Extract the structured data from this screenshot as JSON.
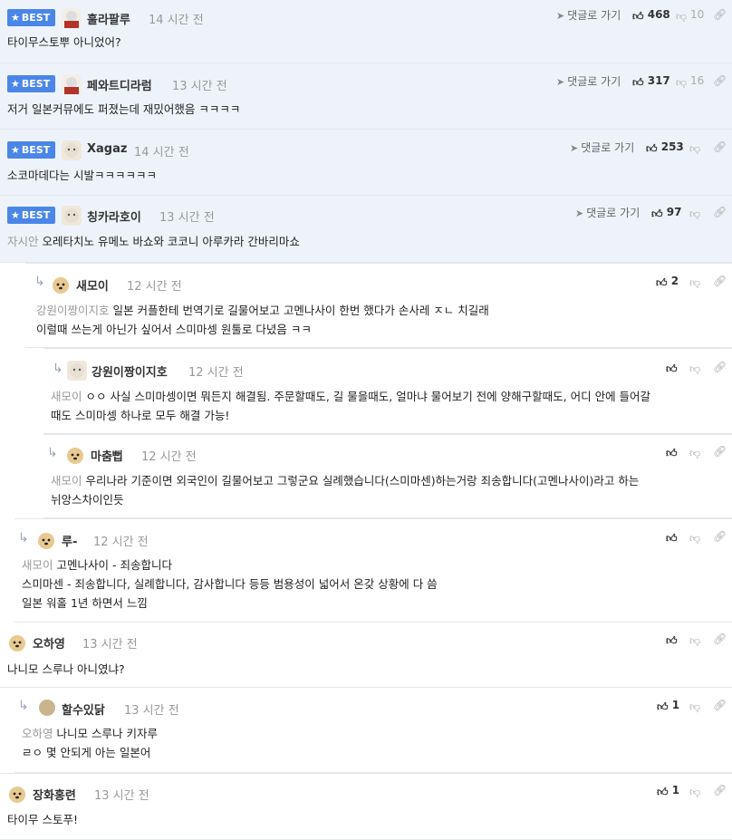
{
  "labels": {
    "best": "BEST",
    "goto": "댓글로 가기",
    "ago": "시간 전"
  },
  "comments": [
    {
      "nick": "훌라팔루",
      "time": "14 시간 전",
      "up": "468",
      "down": "10",
      "text": "타이무스토뿌 아니었어?",
      "mention": ""
    },
    {
      "nick": "페와트디라럼",
      "time": "13 시간 전",
      "up": "317",
      "down": "16",
      "text": "저거 일본커뮤에도 퍼졌는데 재밌어했음 ㅋㅋㅋㅋ",
      "mention": ""
    },
    {
      "nick": "Xagaz",
      "time": "14 시간 전",
      "up": "253",
      "down": "",
      "text": "소코마데다는 시발ㅋㅋㅋㅋㅋㅋ",
      "mention": ""
    },
    {
      "nick": "칭카라호이",
      "time": "13 시간 전",
      "up": "97",
      "down": "",
      "text": "오레타치노 유메노 바쇼와 코코니 아루카라 간바리마쇼",
      "mention": "자시안"
    },
    {
      "nick": "새모이",
      "time": "12 시간 전",
      "up": "2",
      "down": "",
      "text": "일본 커플한테 번역기로 길물어보고 고멘나사이 한번 했다가 손사레 ㅈㄴ 치길래",
      "text2": "이럴때 쓰는게 아닌가 싶어서 스미마셍 원툴로 다녔음 ㅋㅋ",
      "mention": "강원이짱이지호"
    },
    {
      "nick": "강원이짱이지호",
      "time": "12 시간 전",
      "up": "",
      "down": "",
      "text": "ㅇㅇ 사실 스미마셍이면 뭐든지 해결됨. 주문할때도, 길 물을때도, 얼마냐 물어보기 전에 양해구할때도, 어디 안에 들어갈",
      "text2": "때도 스미마셍 하나로 모두 해결 가능!",
      "mention": "새모이"
    },
    {
      "nick": "마춤뻡",
      "time": "12 시간 전",
      "up": "",
      "down": "",
      "text": "우리나라 기준이면 외국인이 길물어보고 그렇군요 실례했습니다(스미마센)하는거랑 죄송합니다(고멘나사이)라고 하는",
      "text2": "뉘앙스차이인듯",
      "mention": "새모이"
    },
    {
      "nick": "루-",
      "time": "12 시간 전",
      "up": "",
      "down": "",
      "text": "고멘나사이 - 죄송합니다",
      "text2": "스미마센 - 죄송합니다, 실례합니다, 감사합니다 등등 범용성이 넓어서 온갖 상황에 다 씀",
      "text3": "일본 워홀 1년 하면서 느낌",
      "mention": "새모이"
    },
    {
      "nick": "오하영",
      "time": "13 시간 전",
      "up": "",
      "down": "",
      "text": "나니모 스루나 아니였냐?",
      "mention": ""
    },
    {
      "nick": "할수있닭",
      "time": "13 시간 전",
      "up": "1",
      "down": "",
      "text": "나니모 스루나 키자루",
      "text2": "ㄹㅇ 몇 안되게 아는 일본어",
      "mention": "오하영"
    },
    {
      "nick": "장화홍련",
      "time": "13 시간 전",
      "up": "1",
      "down": "",
      "text": "타이무 스토푸!",
      "mention": ""
    }
  ]
}
